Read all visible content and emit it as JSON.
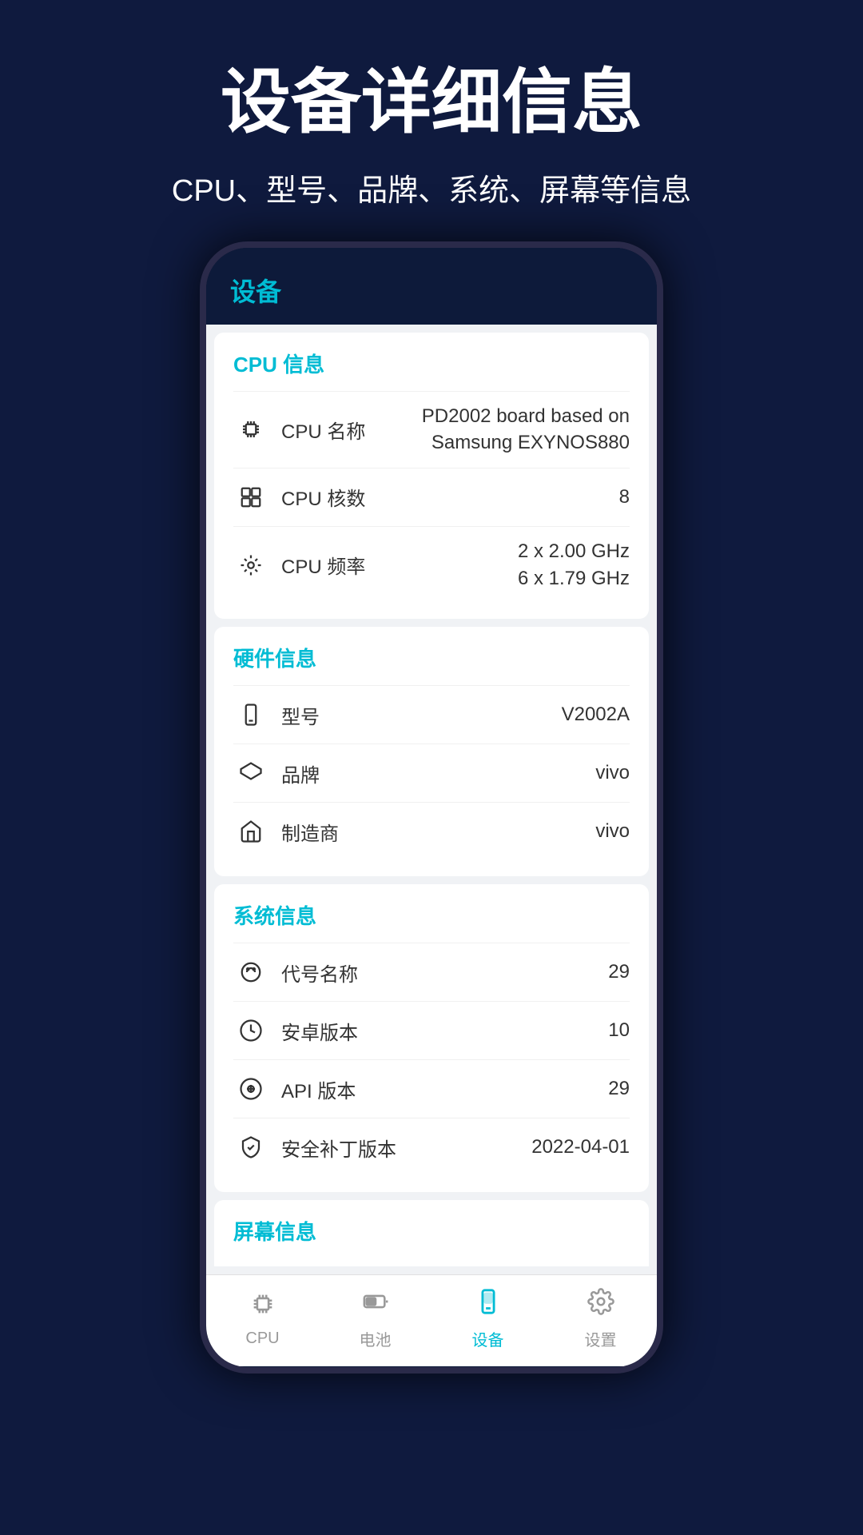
{
  "header": {
    "title": "设备详细信息",
    "subtitle": "CPU、型号、品牌、系统、屏幕等信息"
  },
  "appbar": {
    "title": "设备"
  },
  "sections": [
    {
      "id": "cpu",
      "title": "CPU 信息",
      "rows": [
        {
          "icon": "cpu-chip",
          "label": "CPU 名称",
          "value": "PD2002 board based on Samsung EXYNOS880"
        },
        {
          "icon": "cpu-cores",
          "label": "CPU 核数",
          "value": "8"
        },
        {
          "icon": "cpu-freq",
          "label": "CPU 频率",
          "value": "2 x 2.00 GHz\n6 x 1.79 GHz"
        }
      ]
    },
    {
      "id": "hardware",
      "title": "硬件信息",
      "rows": [
        {
          "icon": "phone",
          "label": "型号",
          "value": "V2002A"
        },
        {
          "icon": "brand",
          "label": "品牌",
          "value": "vivo"
        },
        {
          "icon": "manufacturer",
          "label": "制造商",
          "value": "vivo"
        }
      ]
    },
    {
      "id": "system",
      "title": "系统信息",
      "rows": [
        {
          "icon": "android",
          "label": "代号名称",
          "value": "29"
        },
        {
          "icon": "android-version",
          "label": "安卓版本",
          "value": "10"
        },
        {
          "icon": "api",
          "label": "API 版本",
          "value": "29"
        },
        {
          "icon": "security",
          "label": "安全补丁版本",
          "value": "2022-04-01"
        }
      ]
    },
    {
      "id": "screen",
      "title": "屏幕信息",
      "rows": []
    }
  ],
  "bottomNav": {
    "items": [
      {
        "id": "cpu",
        "label": "CPU",
        "icon": "cpu-nav",
        "active": false
      },
      {
        "id": "battery",
        "label": "电池",
        "icon": "battery-nav",
        "active": false
      },
      {
        "id": "device",
        "label": "设备",
        "icon": "device-nav",
        "active": true
      },
      {
        "id": "settings",
        "label": "设置",
        "icon": "settings-nav",
        "active": false
      }
    ]
  }
}
